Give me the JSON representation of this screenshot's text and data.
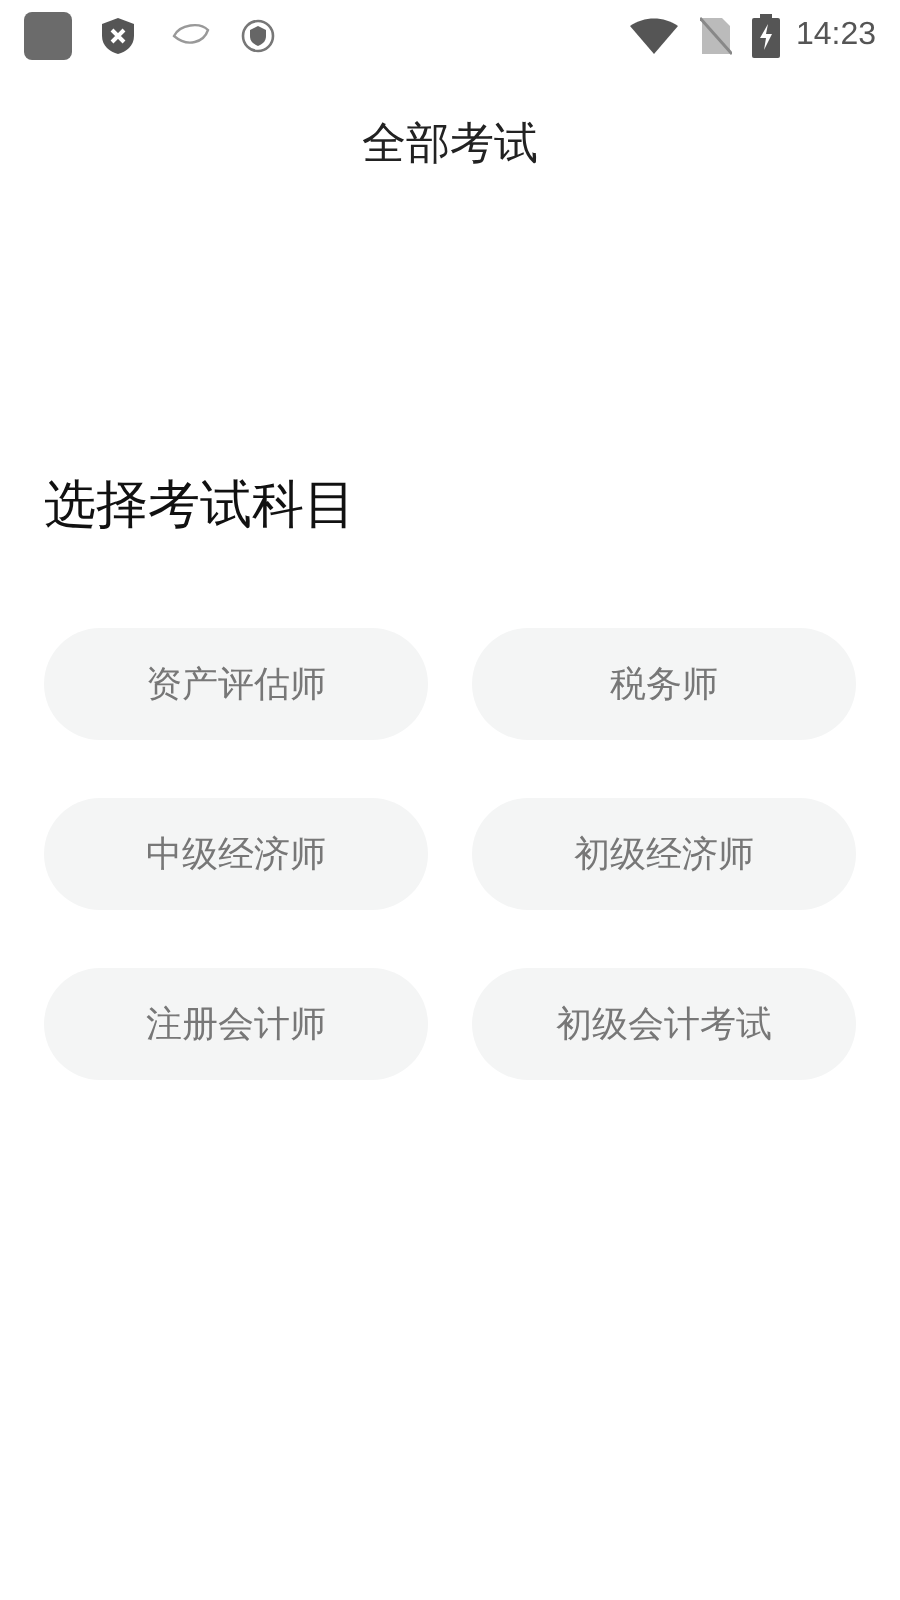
{
  "status_bar": {
    "time": "14:23"
  },
  "header": {
    "title": "全部考试"
  },
  "section": {
    "title": "选择考试科目"
  },
  "subjects": [
    {
      "label": "资产评估师"
    },
    {
      "label": "税务师"
    },
    {
      "label": "中级经济师"
    },
    {
      "label": "初级经济师"
    },
    {
      "label": "注册会计师"
    },
    {
      "label": "初级会计考试"
    }
  ]
}
